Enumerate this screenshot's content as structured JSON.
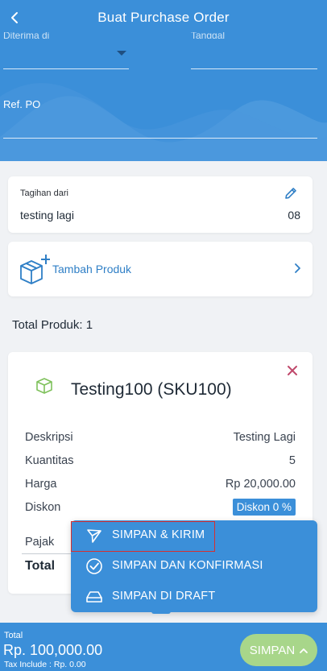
{
  "header": {
    "title": "Buat Purchase Order",
    "cut_label_left": "Diterima di",
    "cut_label_right": "Tanggal",
    "ref_label": "Ref. PO",
    "ref_value": ""
  },
  "billing": {
    "label": "Tagihan dari",
    "name": "testing lagi",
    "code": "08"
  },
  "add_product": {
    "label": "Tambah Produk"
  },
  "total_products": "Total Produk: 1",
  "product": {
    "name": "Testing100 (SKU100)",
    "rows": {
      "description": {
        "label": "Deskripsi",
        "value": "Testing Lagi"
      },
      "quantity": {
        "label": "Kuantitas",
        "value": "5"
      },
      "price": {
        "label": "Harga",
        "value": "Rp 20,000.00"
      },
      "discount": {
        "label": "Diskon",
        "value": "Diskon 0 %"
      },
      "tax": {
        "label": "Pajak"
      },
      "total": {
        "label": "Total"
      }
    }
  },
  "menu": {
    "items": [
      {
        "label": "SIMPAN & KIRIM",
        "icon": "send-icon"
      },
      {
        "label": "SIMPAN DAN KONFIRMASI",
        "icon": "check-circle-icon"
      },
      {
        "label": "SIMPAN DI DRAFT",
        "icon": "drive-icon"
      }
    ]
  },
  "footer": {
    "total_label": "Total",
    "total_amount": "Rp. 100,000.00",
    "tax_include": "Tax Include : Rp. 0.00",
    "save_label": "SIMPAN"
  },
  "colors": {
    "primary": "#3b8fd9",
    "save_button": "#a8d68a",
    "remove": "#c0496b",
    "highlight": "#d62f2f",
    "product_icon": "#7fc15c"
  }
}
